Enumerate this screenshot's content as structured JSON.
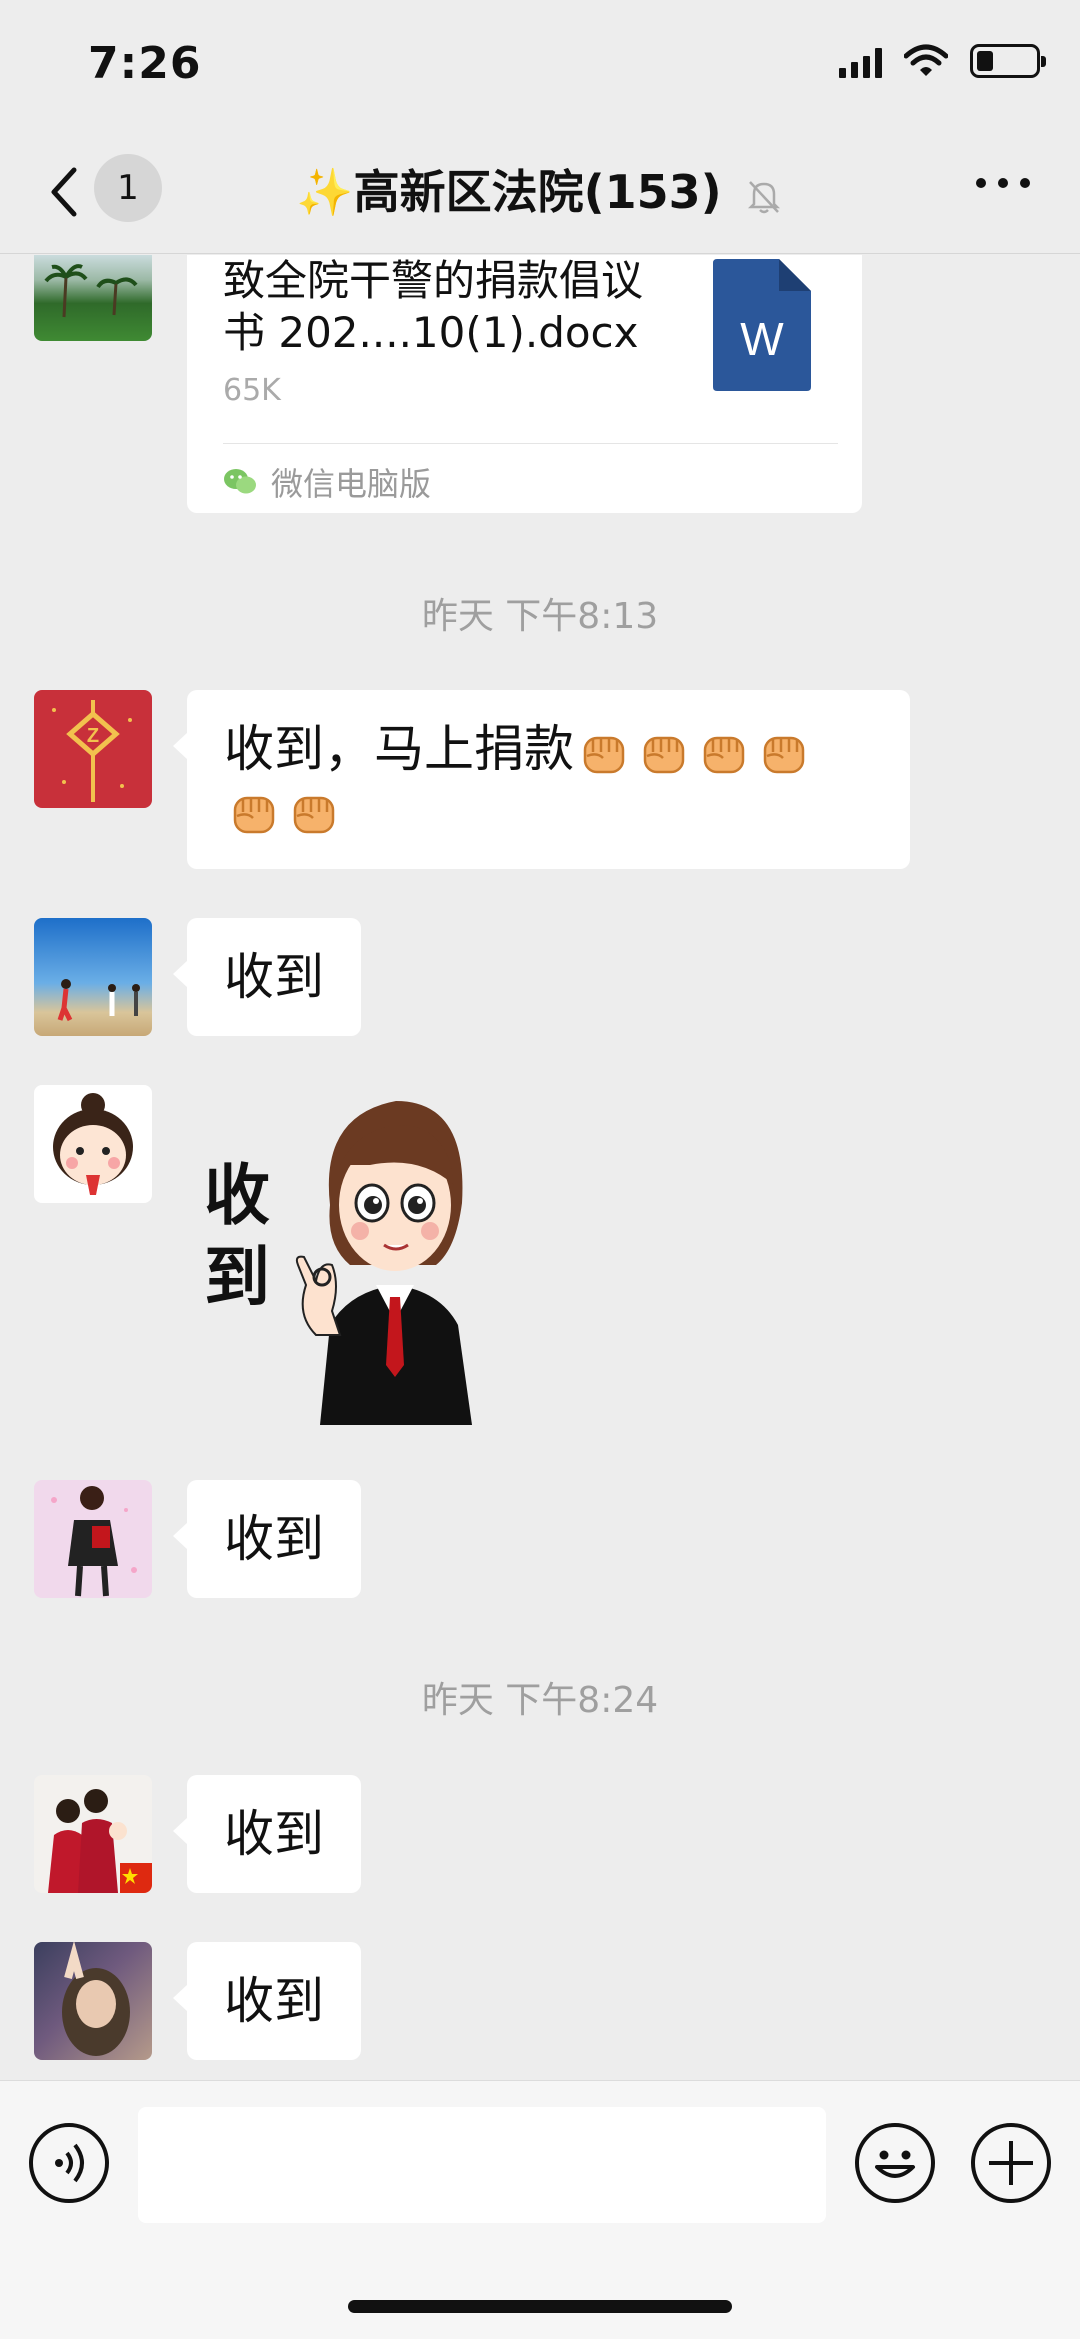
{
  "status_bar": {
    "time": "7:26"
  },
  "nav": {
    "unread_count": "1",
    "title": "✨高新区法院(153)"
  },
  "file_message": {
    "file_name": "致全院干警的捐款倡议书 202....10(1).docx",
    "file_size": "65K",
    "file_type_letter": "W",
    "source": "微信电脑版"
  },
  "timestamps": [
    "昨天 下午8:13",
    "昨天 下午8:24"
  ],
  "messages": [
    {
      "text": "收到，马上捐款",
      "emoji_count": 6,
      "emoji": "fist-emoji"
    },
    {
      "text": "收到"
    },
    {
      "sticker_text": "收到"
    },
    {
      "text": "收到"
    },
    {
      "text": "收到"
    },
    {
      "text": "收到"
    }
  ],
  "colors": {
    "background": "#ededed",
    "bubble": "#ffffff",
    "word_blue": "#2b579a",
    "timestamp": "#9f9f9f"
  }
}
